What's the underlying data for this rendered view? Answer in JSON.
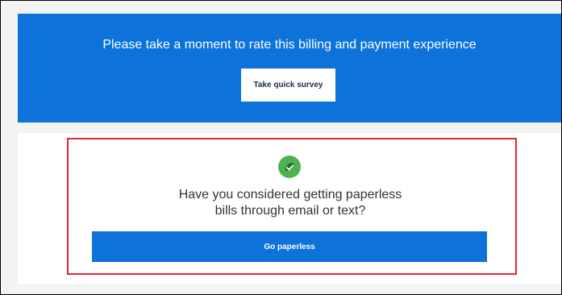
{
  "survey": {
    "prompt": "Please take a moment to rate this billing and payment experience",
    "button_label": "Take quick survey"
  },
  "paperless": {
    "icon": "leaf-check-icon",
    "question_line1": "Have you considered getting paperless",
    "question_line2": "bills through email or text?",
    "button_label": "Go paperless"
  },
  "colors": {
    "accent": "#0d72d9",
    "highlight": "#e3262d",
    "icon_bg": "#4fb24f"
  }
}
